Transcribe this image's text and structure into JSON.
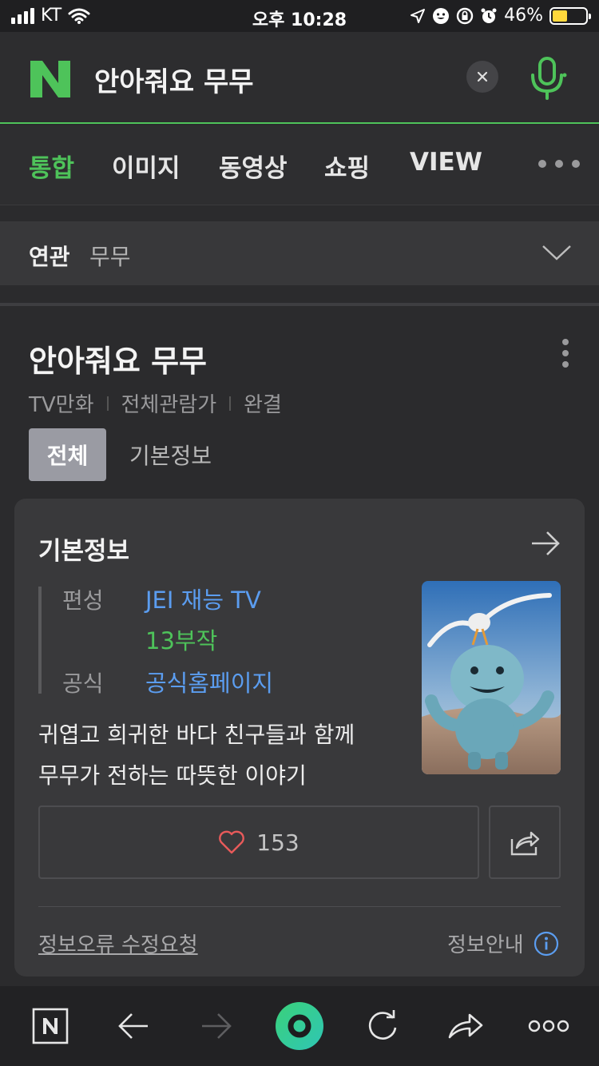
{
  "status_bar": {
    "carrier": "KT",
    "time": "오후 10:28",
    "battery_percent": "46%",
    "battery_level": 0.46
  },
  "search": {
    "query": "안아줘요 무무"
  },
  "tabs": [
    {
      "label": "통합",
      "active": true
    },
    {
      "label": "이미지",
      "active": false
    },
    {
      "label": "동영상",
      "active": false
    },
    {
      "label": "쇼핑",
      "active": false
    },
    {
      "label": "VIEW",
      "active": false
    }
  ],
  "related": {
    "label": "연관",
    "value": "무무"
  },
  "title_block": {
    "title": "안아줘요 무무",
    "meta": [
      "TV만화",
      "전체관람가",
      "완결"
    ],
    "subtab_all": "전체",
    "subtab_info": "기본정보"
  },
  "card": {
    "title": "기본정보",
    "rows": {
      "broadcast_key": "편성",
      "broadcast_val": "JEI 재능 TV",
      "episodes": "13부작",
      "official_key": "공식",
      "official_val": "공식홈페이지"
    },
    "description_line1": "귀엽고 희귀한 바다 친구들과 함께",
    "description_line2": "무무가 전하는 따뜻한 이야기",
    "like_count": "153",
    "report_link": "정보오류 수정요청",
    "guide_label": "정보안내"
  },
  "colors": {
    "accent_green": "#4ec35a",
    "link_blue": "#5b9df0",
    "heart_red": "#e85a5a"
  }
}
